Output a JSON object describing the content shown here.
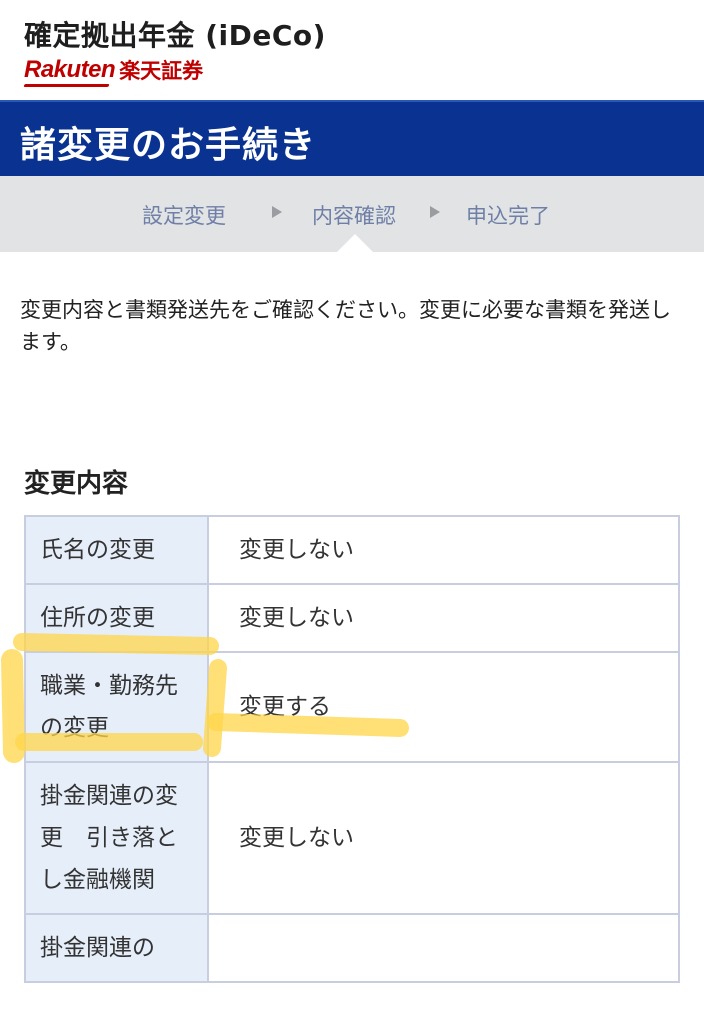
{
  "header": {
    "app_title": "確定拠出年金 (iDeCo)",
    "brand_en": "Rakuten",
    "brand_ja": "楽天証券"
  },
  "banner": {
    "title": "諸変更のお手続き"
  },
  "steps": [
    {
      "label": "設定変更"
    },
    {
      "label": "内容確認"
    },
    {
      "label": "申込完了"
    }
  ],
  "intro_text": "変更内容と書類発送先をご確認ください。変更に必要な書類を発送します。",
  "section": {
    "title": "変更内容"
  },
  "rows": [
    {
      "label": "氏名の変更",
      "value": "変更しない"
    },
    {
      "label": "住所の変更",
      "value": "変更しない"
    },
    {
      "label": "職業・勤務先の変更",
      "value": "変更する"
    },
    {
      "label": "掛金関連の変更　引き落とし金融機関",
      "value": "変更しない"
    },
    {
      "label": "掛金関連の",
      "value": ""
    }
  ],
  "colors": {
    "brand_red": "#bf0000",
    "banner_blue": "#0a3391",
    "highlight_yellow": "#ffd54a"
  }
}
